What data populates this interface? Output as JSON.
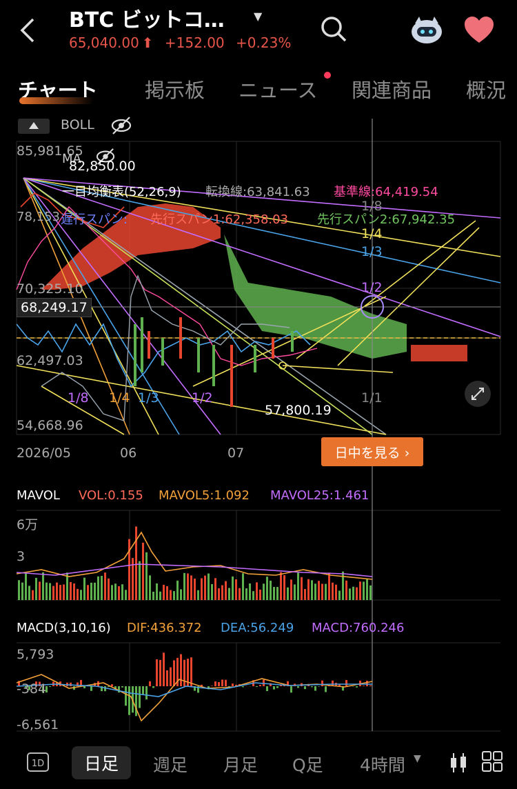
{
  "header": {
    "title": "BTC  ビットコ…",
    "price": "65,040.00",
    "arrow": "⬆",
    "change": "+152.00",
    "change_pct": "+0.23%",
    "accent": "#e8554a"
  },
  "tabs": [
    {
      "label": "チャート",
      "active": true
    },
    {
      "label": "掲示板"
    },
    {
      "label": "ニュース"
    },
    {
      "label": "関連商品"
    },
    {
      "label": "概況"
    }
  ],
  "main_chart": {
    "indicator": "BOLL",
    "ma_label": "MA",
    "ma_value": "82,850.00",
    "price_top": "85,981.65",
    "ichimoku": "一目均衡表(52,26,9)",
    "tenkan": "転換線:63,841.63",
    "kijun": "基準線:64,419.54",
    "chikou": "遅行スパン:",
    "senkou1": "先行スパン1:62,358.03",
    "senkou2": "先行スパン2:67,942.35",
    "left_val": "78,153",
    "y_labels": [
      "70,325.10",
      "62,497.03",
      "54,668.96"
    ],
    "current_price": "68,249.17",
    "low_label": "57,800.19",
    "fib_labels": [
      "1/8",
      "1/4",
      "1/3",
      "1/2",
      "1/1",
      "1/8",
      "1/4",
      "1/3",
      "1/2"
    ],
    "x_labels": [
      "2026/05",
      "06",
      "07"
    ],
    "see_intraday": "日中を見る ›"
  },
  "volume": {
    "title": "MAVOL",
    "vol": "VOL:0.155",
    "mavol5": "MAVOL5:1.092",
    "mavol25": "MAVOL25:1.461",
    "y_labels": [
      "6万",
      "3"
    ]
  },
  "macd": {
    "title": "MACD(3,10,16)",
    "dif": "DIF:436.372",
    "dea": "DEA:56.249",
    "macd": "MACD:760.246",
    "y_labels": [
      "5,793",
      "-384",
      "-6,561"
    ]
  },
  "bottom": {
    "tabs": [
      "日足",
      "週足",
      "月足",
      "Q足",
      "4時間"
    ],
    "one_d": "1D"
  },
  "colors": {
    "up": "#e8452f",
    "down": "#5fb04e",
    "orange": "#f3a13a",
    "purple": "#c26dff",
    "blue": "#4aa3e8",
    "yellow": "#f0e05a"
  }
}
